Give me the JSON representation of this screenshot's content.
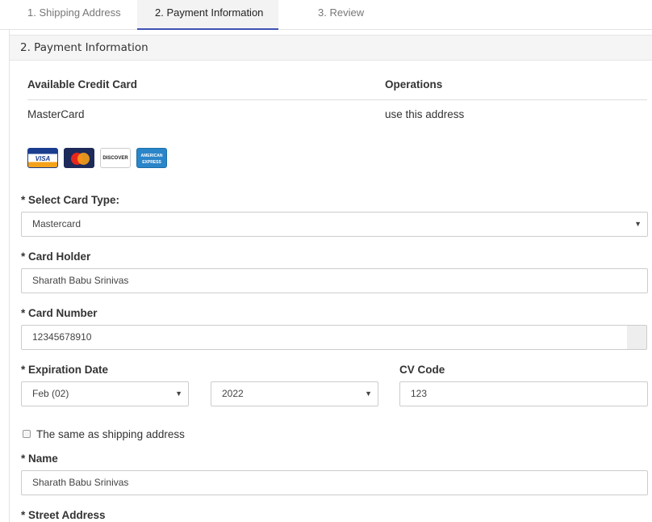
{
  "tabs": [
    {
      "label": "1. Shipping Address"
    },
    {
      "label": "2. Payment Information"
    },
    {
      "label": "3. Review"
    }
  ],
  "panel": {
    "title": "2. Payment Information"
  },
  "card_table": {
    "headers": [
      "Available Credit Card",
      "Operations"
    ],
    "rows": [
      {
        "card": "MasterCard",
        "operation": "use this address"
      }
    ]
  },
  "card_logos": {
    "visa": "VISA",
    "mastercard": "MasterCard",
    "discover": "DISCOVER",
    "amex": "AMERICAN EXPRESS"
  },
  "form": {
    "card_type": {
      "label": "* Select Card Type:",
      "value": "Mastercard"
    },
    "card_holder": {
      "label": "* Card Holder",
      "value": "Sharath Babu Srinivas"
    },
    "card_number": {
      "label": "* Card Number",
      "value": "12345678910"
    },
    "expiration": {
      "label": "* Expiration Date",
      "month": "Feb (02)",
      "year": "2022"
    },
    "cv_code": {
      "label": "CV Code",
      "value": "123"
    },
    "same_as_shipping": {
      "label": "The same as shipping address",
      "checked": false
    },
    "name": {
      "label": "* Name",
      "value": "Sharath Babu Srinivas"
    },
    "street_address": {
      "label": "* Street Address"
    }
  },
  "icons": {
    "caret": "▼"
  }
}
